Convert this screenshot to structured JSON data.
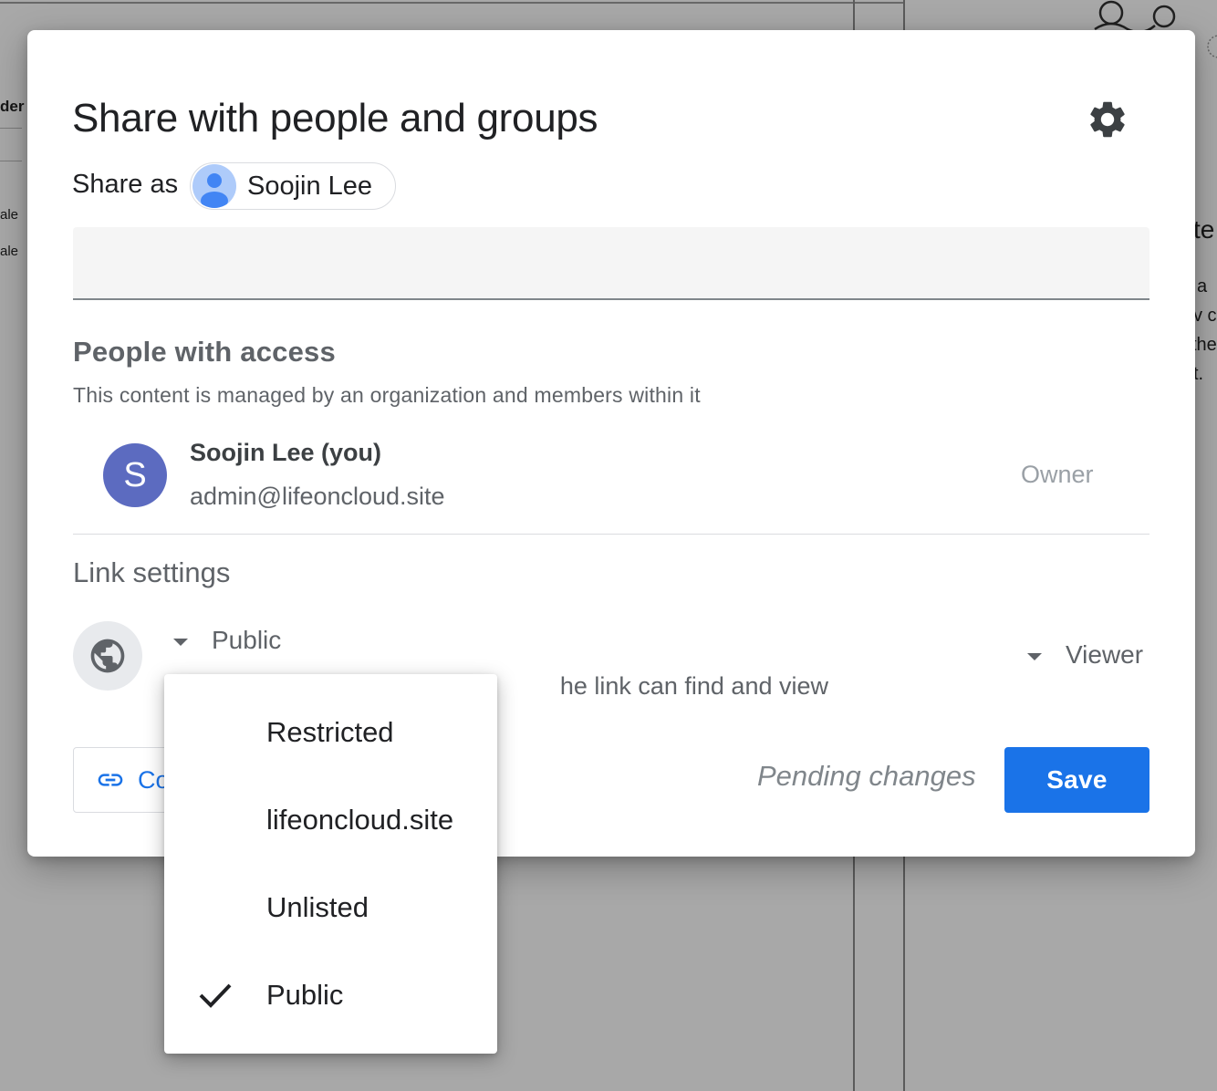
{
  "background": {
    "texts": [
      {
        "id": "bg-der",
        "text": "der"
      },
      {
        "id": "bg-ale-1",
        "text": "ale"
      },
      {
        "id": "bg-ale-2",
        "text": "ale"
      },
      {
        "id": "bg-right-heading",
        "text": "te"
      },
      {
        "id": "bg-right-line-1",
        "text": "a"
      },
      {
        "id": "bg-right-line-2",
        "text": "v c"
      },
      {
        "id": "bg-right-line-3",
        "text": "the"
      },
      {
        "id": "bg-right-line-4",
        "text": "t."
      }
    ]
  },
  "dialog": {
    "title": "Share with people and groups",
    "share_as_label": "Share as",
    "account_name": "Soojin Lee",
    "people_input_placeholder": "",
    "people_section_title": "People with access",
    "managed_note": "This content is managed by an organization and members within it",
    "owner": {
      "avatar_letter": "S",
      "name": "Soojin Lee (you)",
      "email": "admin@lifeoncloud.site",
      "role": "Owner"
    },
    "link_section_title": "Link settings",
    "link_visibility": "Public",
    "link_description": "he link can find and view",
    "link_role": "Viewer",
    "copy_link_label": "Co",
    "pending_text": "Pending changes",
    "save_label": "Save"
  },
  "visibility_menu": {
    "options": [
      {
        "label": "Restricted",
        "selected": false
      },
      {
        "label": "lifeoncloud.site",
        "selected": false
      },
      {
        "label": "Unlisted",
        "selected": false
      },
      {
        "label": "Public",
        "selected": true
      }
    ]
  },
  "colors": {
    "primary": "#1a73e8",
    "owner_avatar": "#5c6bc0",
    "chip_avatar": "#aecbfa",
    "text_secondary": "#5f6368"
  },
  "icons": {
    "settings": "gear-icon",
    "visibility": "globe-icon",
    "copy_link": "link-icon",
    "dropdown": "caret-down-icon",
    "selected": "check-icon",
    "account": "person-icon"
  }
}
